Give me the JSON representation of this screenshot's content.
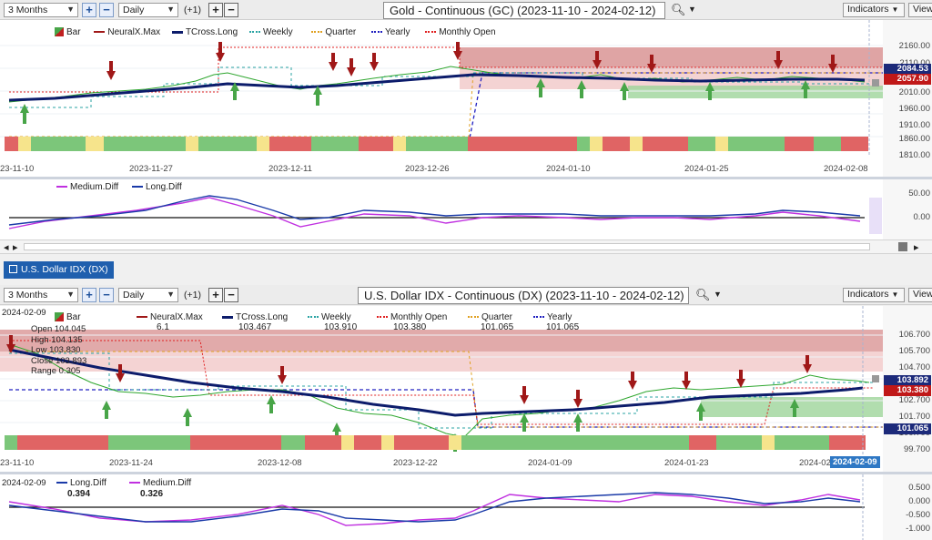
{
  "top": {
    "toolbar": {
      "range": "3 Months",
      "interval": "Daily",
      "offset": "(+1)",
      "title": "Gold - Continuous (GC) (2023-11-10 - 2024-02-12)",
      "indicators": "Indicators",
      "view": "View"
    },
    "legend": {
      "bar": "Bar",
      "neural": "NeuralX.Max",
      "tcross": "TCross.Long",
      "weekly": "Weekly",
      "quarter": "Quarter",
      "yearly": "Yearly",
      "monthly": "Monthly Open"
    },
    "yticks": [
      "2160.00",
      "2110.00",
      "2060.00",
      "2010.00",
      "1960.00",
      "1910.00",
      "1860.00",
      "1810.00"
    ],
    "price_tag_1": "2084.53",
    "price_tag_2": "2057.90",
    "xticks": [
      "23-11-10",
      "2023-11-27",
      "2023-12-11",
      "2023-12-26",
      "2024-01-10",
      "2024-01-25",
      "2024-02-08"
    ],
    "sub_legend": {
      "medium": "Medium.Diff",
      "long": "Long.Diff"
    },
    "sub_yticks": [
      "50.00",
      "0.00"
    ]
  },
  "tab": {
    "label": "U.S. Dollar IDX (DX)"
  },
  "bottom": {
    "toolbar": {
      "range": "3 Months",
      "interval": "Daily",
      "offset": "(+1)",
      "title": "U.S. Dollar IDX - Continuous (DX) (2023-11-10 - 2024-02-12)",
      "indicators": "Indicators",
      "view": "View"
    },
    "date": "2024-02-09",
    "legend": {
      "bar": "Bar",
      "neural": "NeuralX.Max",
      "neural_val": "6.1",
      "tcross": "TCross.Long",
      "tcross_val": "103.467",
      "weekly": "Weekly",
      "weekly_val": "103.910",
      "monthly": "Monthly Open",
      "monthly_val": "103.380",
      "quarter": "Quarter",
      "quarter_val": "101.065",
      "yearly": "Yearly",
      "yearly_val": "101.065"
    },
    "ohlc": {
      "open": "Open",
      "open_val": "104.045",
      "high": "High",
      "high_val": "104.135",
      "low": "Low",
      "low_val": "103.830",
      "close": "Close",
      "close_val": "103.893",
      "range": "Range",
      "range_val": "0.305"
    },
    "yticks": [
      "106.700",
      "105.700",
      "104.700",
      "103.700",
      "102.700",
      "101.700",
      "100.700",
      "99.700"
    ],
    "price_tag_1": "103.892",
    "price_tag_2": "103.380",
    "price_tag_3": "101.065",
    "xticks": [
      "23-11-10",
      "2023-11-24",
      "2023-12-08",
      "2023-12-22",
      "2024-01-09",
      "2024-01-23",
      "2024-02"
    ],
    "xcursor": "2024-02-09",
    "sub_date": "2024-02-09",
    "sub_legend": {
      "long": "Long.Diff",
      "long_val": "0.394",
      "medium": "Medium.Diff",
      "medium_val": "0.326"
    },
    "sub_yticks": [
      "0.500",
      "0.000",
      "-0.500",
      "-1.000"
    ]
  },
  "colors": {
    "tcross": "#0c1c6b",
    "neural_red": "#a01818",
    "neural_green": "#48a548",
    "weekly": "#29a3a3",
    "quarter": "#e0a020",
    "yearly": "#2020c0",
    "monthly": "#e02020",
    "medium": "#c030e0",
    "long": "#1a3aa8"
  }
}
